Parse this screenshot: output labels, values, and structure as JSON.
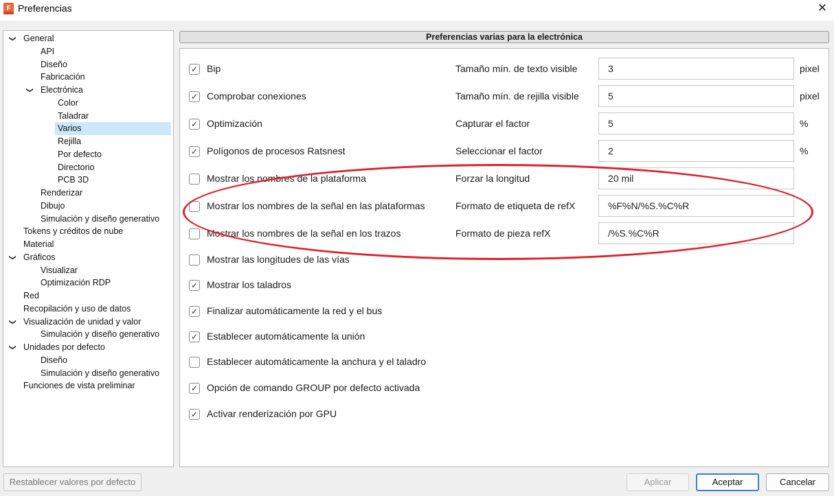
{
  "window": {
    "title": "Preferencias",
    "app_icon": "F",
    "close_symbol": "✕"
  },
  "tree": {
    "items": [
      {
        "label": "General",
        "expanded": true
      },
      {
        "label": "API"
      },
      {
        "label": "Diseño"
      },
      {
        "label": "Fabricación"
      },
      {
        "label": "Electrónica",
        "expanded": true
      },
      {
        "label": "Color"
      },
      {
        "label": "Taladrar"
      },
      {
        "label": "Varios",
        "selected": true
      },
      {
        "label": "Rejilla"
      },
      {
        "label": "Por defecto"
      },
      {
        "label": "Directorio"
      },
      {
        "label": "PCB 3D"
      },
      {
        "label": "Renderizar"
      },
      {
        "label": "Dibujo"
      },
      {
        "label": "Simulación y diseño generativo"
      },
      {
        "label": "Tokens y créditos de nube"
      },
      {
        "label": "Material"
      },
      {
        "label": "Gráficos",
        "expanded": true
      },
      {
        "label": "Visualizar"
      },
      {
        "label": "Optimización RDP"
      },
      {
        "label": "Red"
      },
      {
        "label": "Recopilación y uso de datos"
      },
      {
        "label": "Visualización de unidad y valor",
        "expanded": true
      },
      {
        "label": "Simulación y diseño generativo"
      },
      {
        "label": "Unidades por defecto",
        "expanded": true
      },
      {
        "label": "Diseño"
      },
      {
        "label": "Simulación y diseño generativo"
      },
      {
        "label": "Funciones de vista preliminar"
      }
    ]
  },
  "section": {
    "title": "Preferencias varias para la electrónica"
  },
  "checkboxes": [
    {
      "label": "Bip",
      "checked": true
    },
    {
      "label": "Comprobar conexiones",
      "checked": true
    },
    {
      "label": "Optimización",
      "checked": true
    },
    {
      "label": "Polígonos de procesos Ratsnest",
      "checked": true
    },
    {
      "label": "Mostrar los nombres de la plataforma",
      "checked": false
    },
    {
      "label": "Mostrar los nombres de la señal en las plataformas",
      "checked": false
    },
    {
      "label": "Mostrar los nombres de la señal en los trazos",
      "checked": false
    },
    {
      "label": "Mostrar las longitudes de las vías",
      "checked": false
    },
    {
      "label": "Mostrar los taladros",
      "checked": true
    },
    {
      "label": "Finalizar automáticamente la red y el bus",
      "checked": true
    },
    {
      "label": "Establecer automáticamente la unión",
      "checked": true
    },
    {
      "label": "Establecer automáticamente la anchura y el taladro",
      "checked": false
    },
    {
      "label": "Opción de comando GROUP por defecto activada",
      "checked": true
    },
    {
      "label": "Activar renderización por GPU",
      "checked": true
    }
  ],
  "fields": [
    {
      "label": "Tamaño mín. de texto visible",
      "value": "3",
      "unit": "pixel"
    },
    {
      "label": "Tamaño mín. de rejilla visible",
      "value": "5",
      "unit": "pixel"
    },
    {
      "label": "Capturar el factor",
      "value": "5",
      "unit": "%"
    },
    {
      "label": "Seleccionar el factor",
      "value": "2",
      "unit": "%"
    },
    {
      "label": "Forzar la longitud",
      "value": "20 mil",
      "unit": ""
    },
    {
      "label": "Formato de etiqueta de refX",
      "value": "%F%N/%S.%C%R",
      "unit": ""
    },
    {
      "label": "Formato de pieza refX",
      "value": "/%S.%C%R",
      "unit": ""
    }
  ],
  "buttons": {
    "reset": "Restablecer valores por defecto",
    "apply": "Aplicar",
    "accept": "Aceptar",
    "cancel": "Cancelar"
  },
  "colors": {
    "highlight": "#e0202b",
    "selection": "#cde8fb",
    "primary_border": "#3c7fd0"
  },
  "icons": {
    "check": "check-icon",
    "chevron": "chevron-down-icon",
    "close": "close-icon"
  }
}
